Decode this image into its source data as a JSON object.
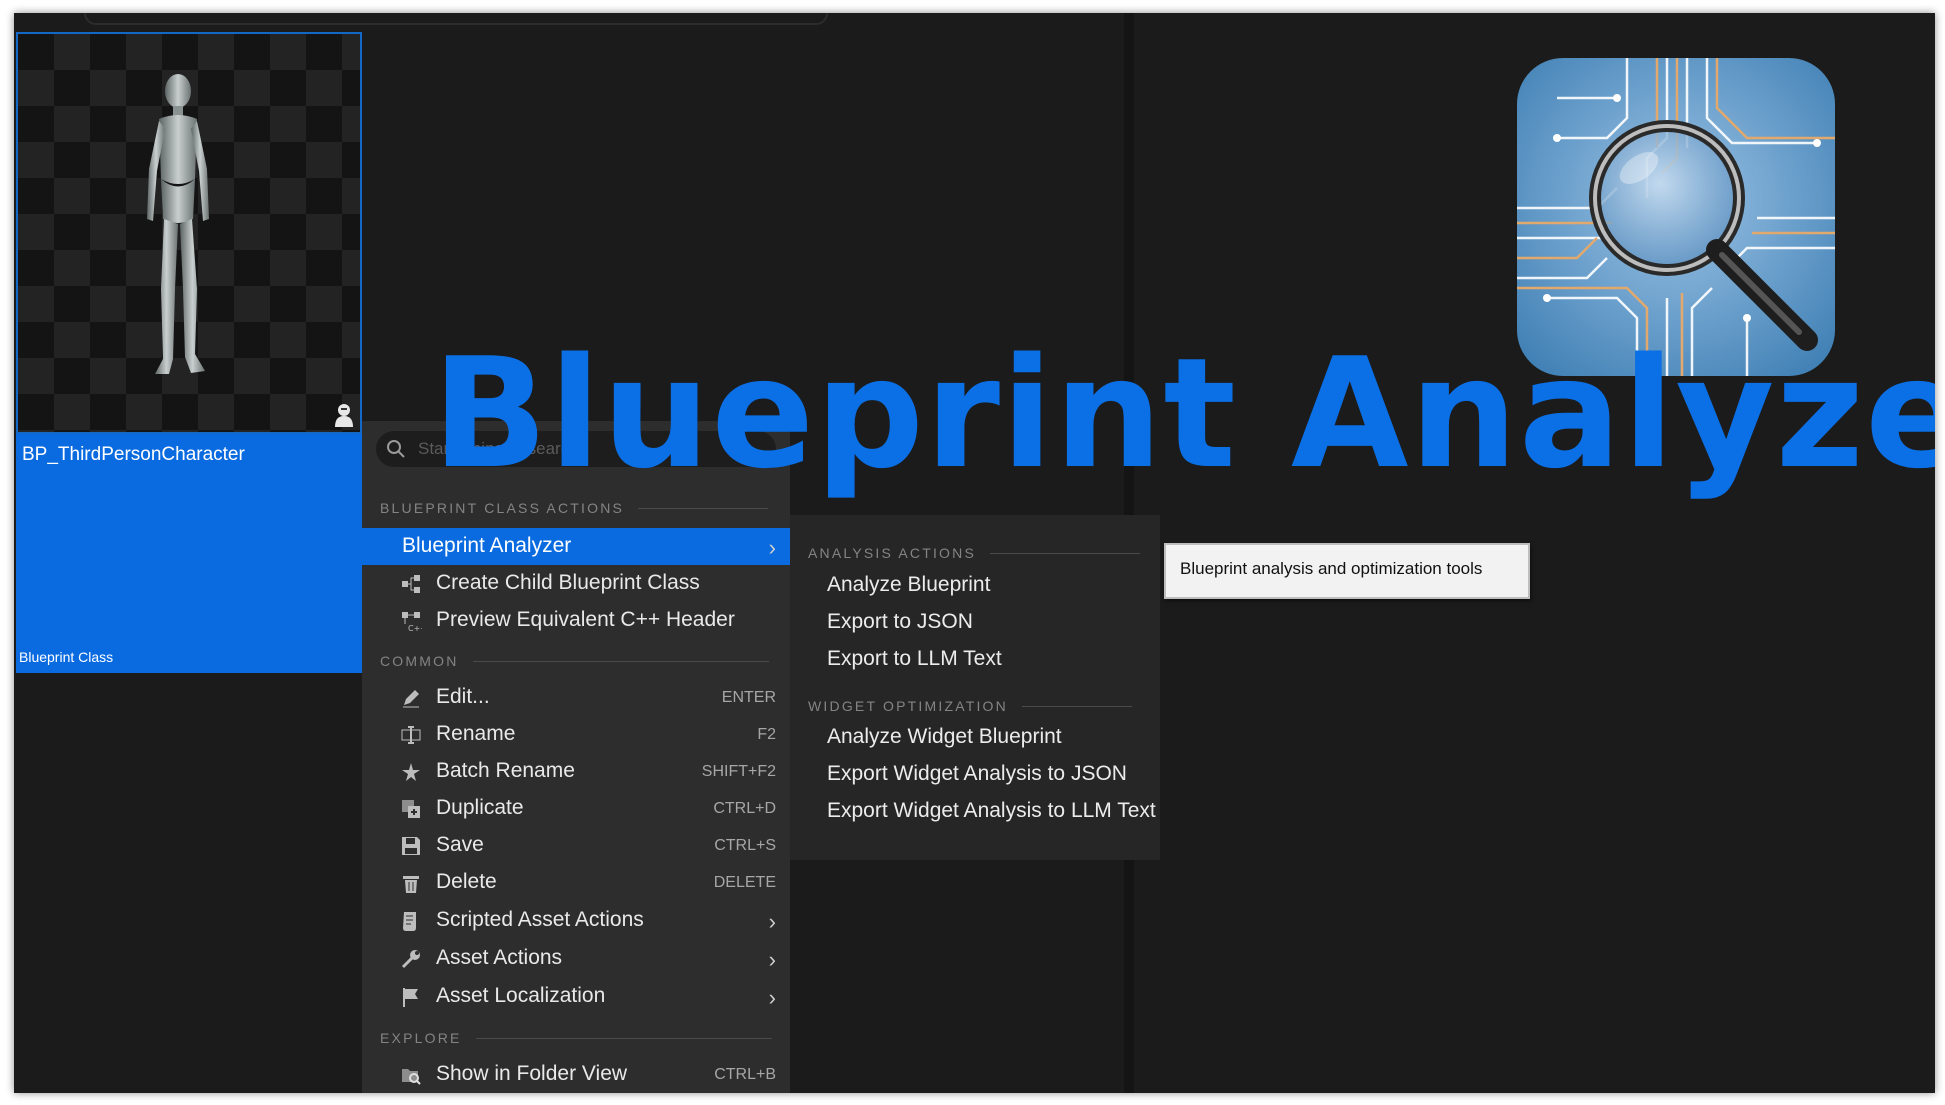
{
  "asset": {
    "name": "BP_ThirdPersonCharacter",
    "type": "Blueprint Class",
    "thumbnail_icon": "humanoid-figure",
    "badge_icon": "actor-icon"
  },
  "search": {
    "placeholder": "Start typing to search"
  },
  "menu": {
    "sections": {
      "class_actions": "BLUEPRINT CLASS ACTIONS",
      "common": "COMMON",
      "explore": "EXPLORE"
    },
    "class_actions": [
      {
        "label": "Blueprint Analyzer",
        "has_submenu": true,
        "highlighted": true
      },
      {
        "label": "Create Child Blueprint Class",
        "icon": "class-hierarchy-icon"
      },
      {
        "label": "Preview Equivalent C++ Header",
        "icon": "cpp-header-icon"
      }
    ],
    "common": [
      {
        "label": "Edit...",
        "shortcut": "ENTER",
        "icon": "pencil-icon"
      },
      {
        "label": "Rename",
        "shortcut": "F2",
        "icon": "rename-icon"
      },
      {
        "label": "Batch Rename",
        "shortcut": "SHIFT+F2",
        "icon": "batch-rename-icon"
      },
      {
        "label": "Duplicate",
        "shortcut": "CTRL+D",
        "icon": "duplicate-icon"
      },
      {
        "label": "Save",
        "shortcut": "CTRL+S",
        "icon": "save-icon"
      },
      {
        "label": "Delete",
        "shortcut": "DELETE",
        "icon": "trash-icon"
      },
      {
        "label": "Scripted Asset Actions",
        "has_submenu": true,
        "icon": "script-icon"
      },
      {
        "label": "Asset Actions",
        "has_submenu": true,
        "icon": "wrench-icon"
      },
      {
        "label": "Asset Localization",
        "has_submenu": true,
        "icon": "flag-icon"
      }
    ],
    "explore": [
      {
        "label": "Show in Folder View",
        "shortcut": "CTRL+B",
        "icon": "folder-search-icon"
      }
    ]
  },
  "submenu": {
    "sections": {
      "analysis": "ANALYSIS ACTIONS",
      "widget": "WIDGET OPTIMIZATION"
    },
    "analysis_items": [
      "Analyze Blueprint",
      "Export to JSON",
      "Export to LLM Text"
    ],
    "widget_items": [
      "Analyze Widget Blueprint",
      "Export Widget Analysis to JSON",
      "Export Widget Analysis to LLM Text"
    ]
  },
  "tooltip": {
    "text": "Blueprint analysis and optimization tools"
  },
  "banner": {
    "title": "Blueprint Analyzer",
    "logo_icon": "magnifier-circuit-icon"
  },
  "colors": {
    "accent": "#0a6be0",
    "title": "#0b6fe6",
    "menu_bg": "#2d2d2d",
    "panel_bg": "#1b1b1b"
  }
}
